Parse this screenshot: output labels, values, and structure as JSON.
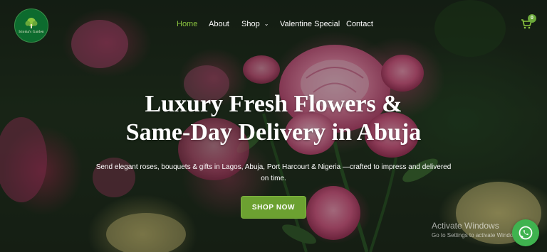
{
  "header": {
    "logo": {
      "text": "Isioma's Garden",
      "icon": "leaf-tree-logo"
    },
    "nav": [
      {
        "label": "Home",
        "active": true
      },
      {
        "label": "About",
        "active": false
      },
      {
        "label": "Shop",
        "active": false,
        "has_dropdown": true
      },
      {
        "label": "Valentine Special",
        "active": false
      },
      {
        "label": "Contact",
        "active": false
      }
    ],
    "cart": {
      "icon": "shopping-cart-icon",
      "count": "0"
    }
  },
  "hero": {
    "headline_line1": "Luxury Fresh Flowers &",
    "headline_line2": "Same-Day Delivery in Abuja",
    "subtext": "Send elegant roses, bouquets & gifts in Lagos, Abuja, Port Harcourt & Nigeria —crafted to impress and delivered on time.",
    "cta_label": "SHOP NOW"
  },
  "overlays": {
    "activate_title": "Activate Windows",
    "activate_sub": "Go to Settings to activate Windows.",
    "whatsapp_icon": "whatsapp-icon"
  },
  "colors": {
    "accent_green": "#6ca131",
    "nav_active": "#8cc63f",
    "logo_bg": "#0d6b2e",
    "whatsapp_green": "#3fb34f"
  }
}
